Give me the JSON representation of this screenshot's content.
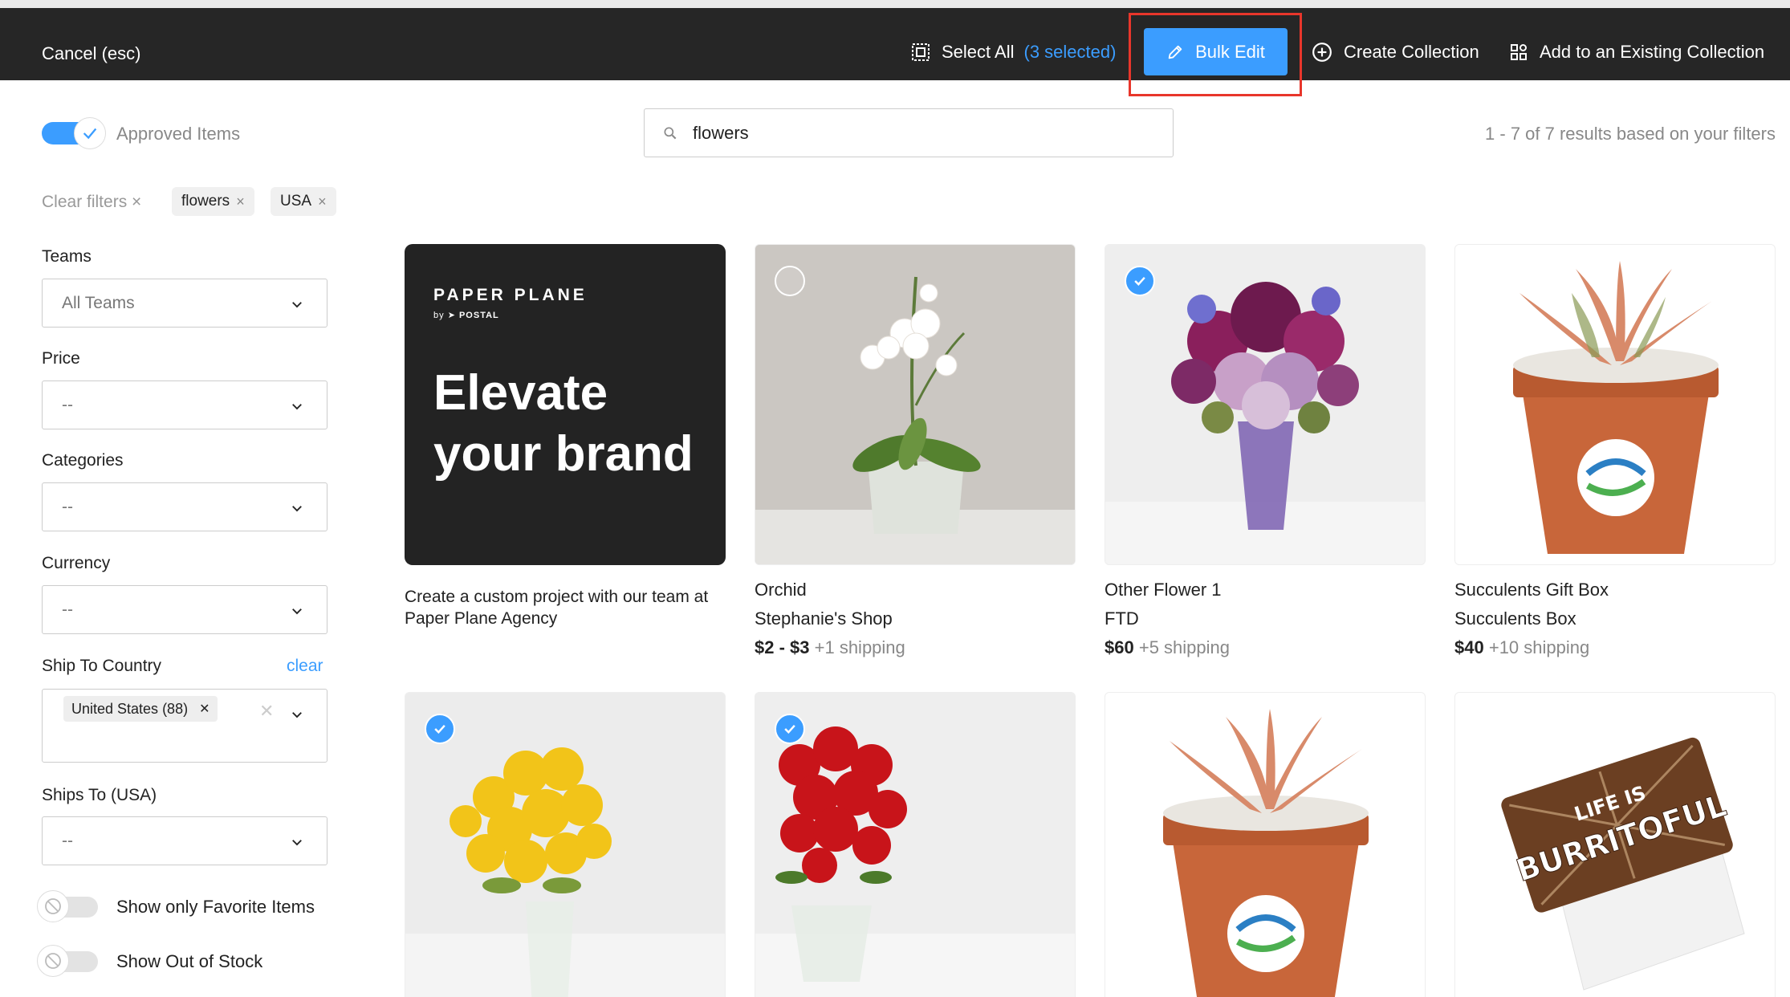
{
  "topbar": {
    "cancel_label": "Cancel (esc)",
    "select_all_label": "Select All",
    "selected_count": "(3 selected)",
    "bulk_edit_label": "Bulk Edit",
    "create_collection_label": "Create Collection",
    "add_existing_label": "Add to an Existing Collection"
  },
  "filters_bar": {
    "approved_label": "Approved Items",
    "approved_on": true,
    "search_value": "flowers",
    "results_text": "1 - 7 of 7 results based on your filters",
    "clear_filters_label": "Clear filters",
    "chips": [
      "flowers",
      "USA"
    ]
  },
  "sidebar": {
    "teams_label": "Teams",
    "teams_value": "All Teams",
    "price_label": "Price",
    "price_value": "--",
    "categories_label": "Categories",
    "categories_value": "--",
    "currency_label": "Currency",
    "currency_value": "--",
    "ship_country_label": "Ship To Country",
    "ship_country_clear": "clear",
    "ship_country_tag": "United States (88)",
    "ships_usa_label": "Ships To (USA)",
    "ships_usa_value": "--",
    "favorites_label": "Show only Favorite Items",
    "out_of_stock_label": "Show Out of Stock"
  },
  "promo": {
    "brand": "PAPER PLANE",
    "by": "by",
    "by_brand": "POSTAL",
    "headline_line1": "Elevate",
    "headline_line2": "your brand",
    "description": "Create a custom project with our team at Paper Plane Agency"
  },
  "products": [
    {
      "title": "Orchid",
      "vendor": "Stephanie's Shop",
      "price": "$2 - $3",
      "shipping": "+1 shipping",
      "selected": false
    },
    {
      "title": "Other Flower 1",
      "vendor": "FTD",
      "price": "$60",
      "shipping": "+5 shipping",
      "selected": true
    },
    {
      "title": "Succulents Gift Box",
      "vendor": "Succulents Box",
      "price": "$40",
      "shipping": "+10 shipping",
      "selected": false
    },
    {
      "title": "",
      "vendor": "",
      "price": "",
      "shipping": "",
      "selected": true
    },
    {
      "title": "",
      "vendor": "",
      "price": "",
      "shipping": "",
      "selected": true
    },
    {
      "title": "",
      "vendor": "",
      "price": "",
      "shipping": "",
      "selected": false
    },
    {
      "title": "",
      "vendor": "",
      "price": "",
      "shipping": "",
      "selected": false
    }
  ],
  "gift_card_text": {
    "line1": "LIFE IS",
    "line2": "BURRITOFUL"
  },
  "colors": {
    "accent": "#3b9dff",
    "topbar": "#262626",
    "highlight": "#e8362b"
  }
}
